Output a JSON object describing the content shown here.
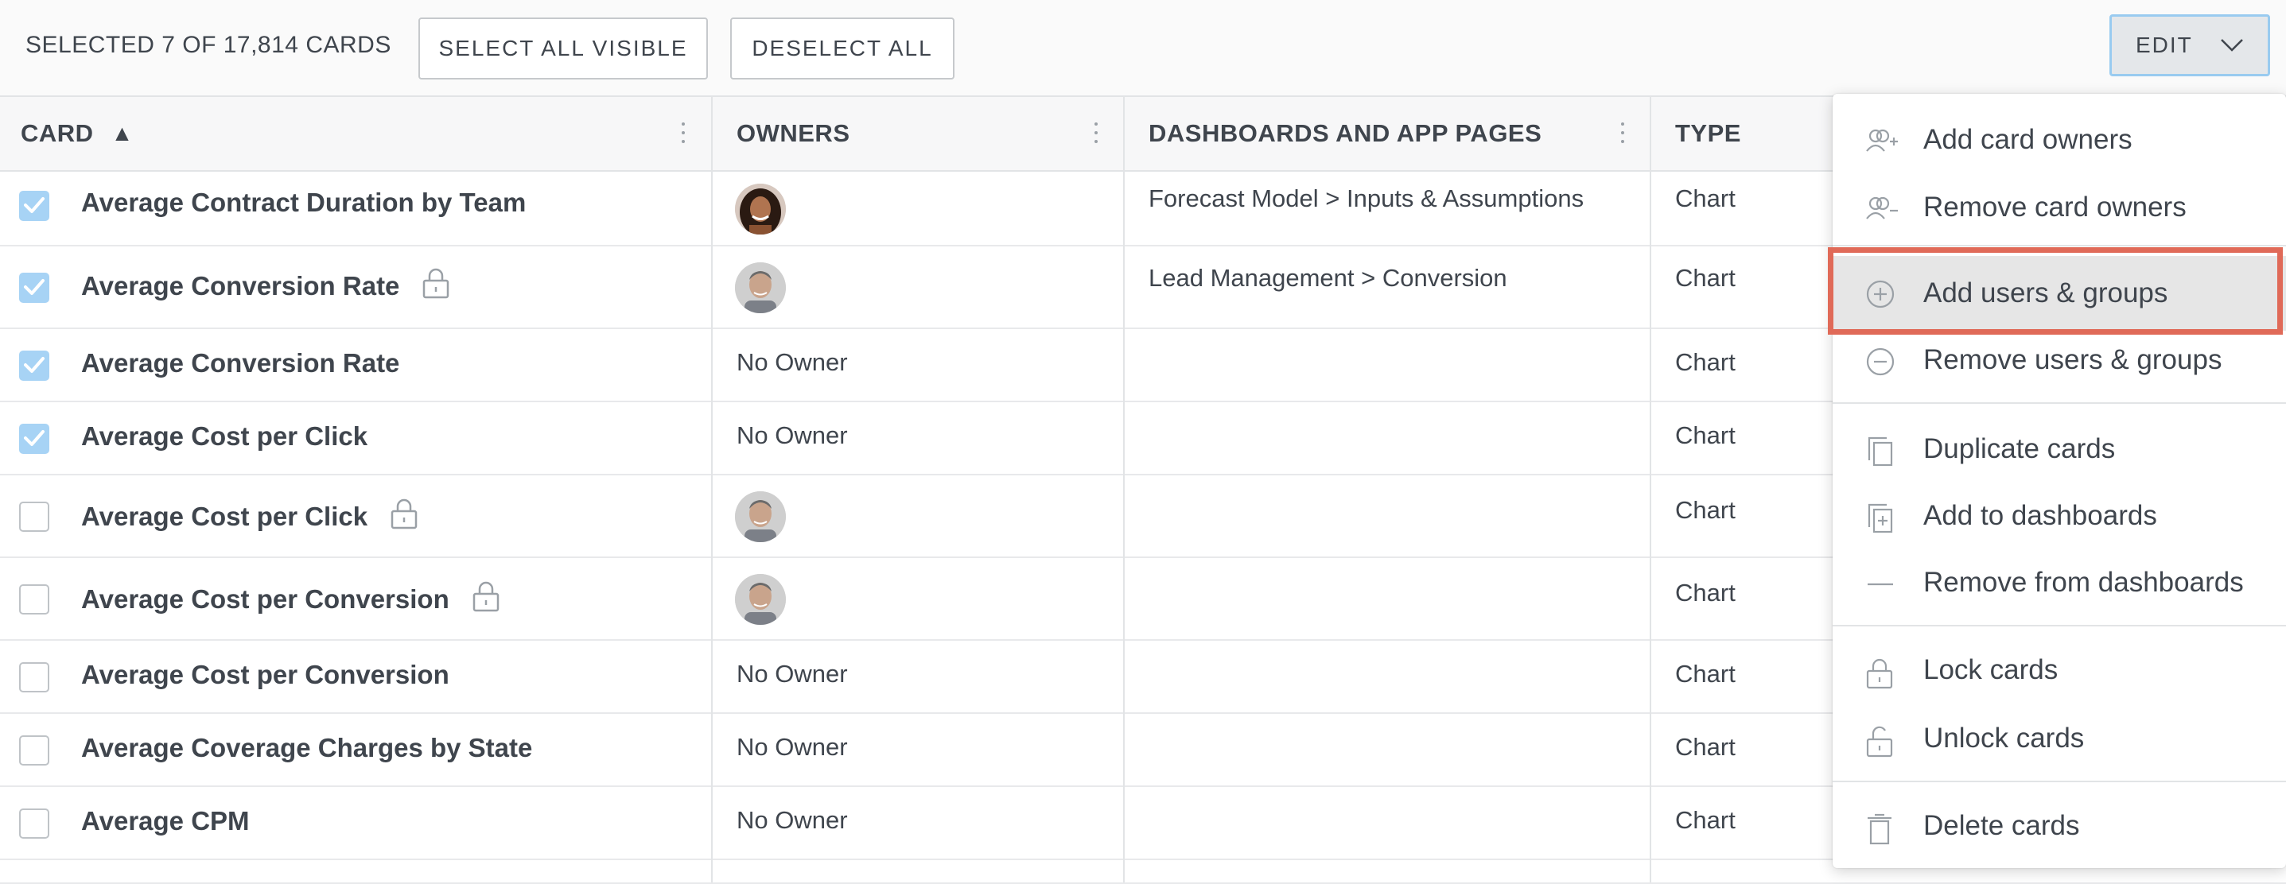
{
  "toolbar": {
    "selection_text": "SELECTED 7 OF 17,814 CARDS",
    "select_all_visible": "SELECT ALL VISIBLE",
    "deselect_all": "DESELECT ALL",
    "edit": "EDIT"
  },
  "table": {
    "headers": {
      "card": "CARD",
      "sort_indicator": "▲",
      "owners": "OWNERS",
      "dashboards": "DASHBOARDS AND APP PAGES",
      "type": "TYPE"
    },
    "rows": [
      {
        "checked": true,
        "name": "Average Contract Duration by Team",
        "locked": false,
        "owner": "avatar-woman",
        "dashboards": "Forecast Model > Inputs & Assumptions",
        "type": "Chart"
      },
      {
        "checked": true,
        "name": "Average Conversion Rate",
        "locked": true,
        "owner": "avatar-man",
        "dashboards": "Lead Management > Conversion",
        "type": "Chart"
      },
      {
        "checked": true,
        "name": "Average Conversion Rate",
        "locked": false,
        "owner": "No Owner",
        "dashboards": "",
        "type": "Chart"
      },
      {
        "checked": true,
        "name": "Average Cost per Click",
        "locked": false,
        "owner": "No Owner",
        "dashboards": "",
        "type": "Chart"
      },
      {
        "checked": false,
        "name": "Average Cost per Click",
        "locked": true,
        "owner": "avatar-man",
        "dashboards": "",
        "type": "Chart"
      },
      {
        "checked": false,
        "name": "Average Cost per Conversion",
        "locked": true,
        "owner": "avatar-man",
        "dashboards": "",
        "type": "Chart"
      },
      {
        "checked": false,
        "name": "Average Cost per Conversion",
        "locked": false,
        "owner": "No Owner",
        "dashboards": "",
        "type": "Chart"
      },
      {
        "checked": false,
        "name": "Average Coverage Charges by State",
        "locked": false,
        "owner": "No Owner",
        "dashboards": "",
        "type": "Chart"
      },
      {
        "checked": false,
        "name": "Average CPM",
        "locked": false,
        "owner": "No Owner",
        "dashboards": "",
        "type": "Chart"
      }
    ]
  },
  "edit_menu": {
    "items": [
      {
        "label": "Add card owners",
        "icon": "add-person-icon"
      },
      {
        "label": "Remove card owners",
        "icon": "remove-person-icon"
      },
      {
        "label": "Add users & groups",
        "icon": "plus-circle-icon",
        "highlighted": true
      },
      {
        "label": "Remove users & groups",
        "icon": "minus-circle-icon"
      },
      {
        "label": "Duplicate cards",
        "icon": "duplicate-icon"
      },
      {
        "label": "Add to dashboards",
        "icon": "add-to-dashboard-icon"
      },
      {
        "label": "Remove from dashboards",
        "icon": "dash-icon"
      },
      {
        "label": "Lock cards",
        "icon": "lock-icon"
      },
      {
        "label": "Unlock cards",
        "icon": "unlock-icon"
      },
      {
        "label": "Delete cards",
        "icon": "trash-icon"
      }
    ]
  },
  "colors": {
    "accent_checkbox": "#a7d3f5",
    "highlight_border": "#e06a58",
    "edit_border": "#99cbf0"
  }
}
